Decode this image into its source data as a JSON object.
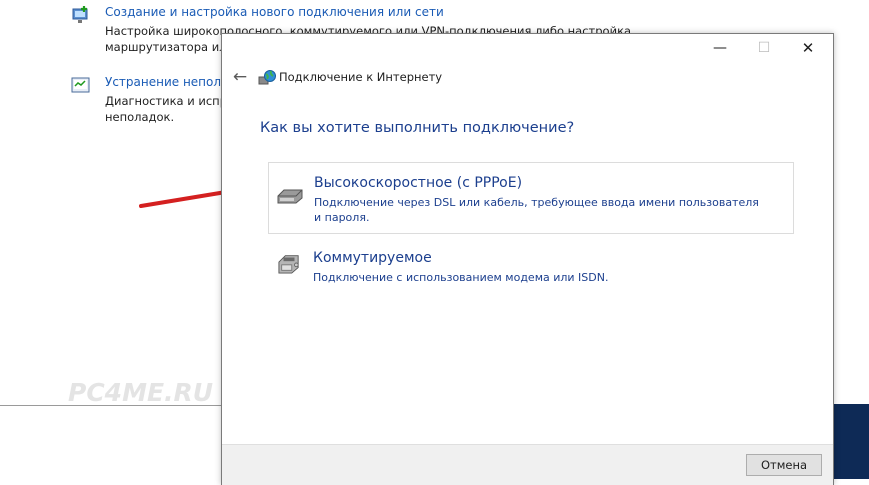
{
  "control_panel": {
    "items": [
      {
        "link": "Создание и настройка нового подключения или сети",
        "desc_lines": [
          "Настройка широкополосного, коммутируемого или VPN-подключения либо настройка",
          "маршрутизатора или точки доступа."
        ],
        "icon": "network-setup-icon"
      },
      {
        "link": "Устранение неполадок",
        "desc_lines": [
          "Диагностика и исправление проблем с сетью или получение сведений об устранении",
          "неполадок."
        ],
        "icon": "troubleshoot-icon"
      }
    ],
    "watermark": "PC4ME.RU"
  },
  "dialog": {
    "title": "Подключение к Интернету",
    "window_buttons": {
      "minimize": "—",
      "maximize": "☐",
      "close": "✕"
    },
    "back": "←",
    "question": "Как вы хотите выполнить подключение?",
    "options": [
      {
        "title": "Высокоскоростное (с PPPoE)",
        "desc": "Подключение через DSL или кабель, требующее ввода имени пользователя и пароля.",
        "icon": "modem-icon",
        "selected": true
      },
      {
        "title": "Коммутируемое",
        "desc": "Подключение с использованием модема или ISDN.",
        "icon": "dialup-phone-icon",
        "selected": false
      }
    ],
    "cancel_label": "Отмена"
  },
  "colors": {
    "link_blue": "#1a5bb5",
    "heading_blue": "#1c3f8e",
    "arrow_red": "#d42020",
    "taskbar_blue": "#0e2a56"
  }
}
